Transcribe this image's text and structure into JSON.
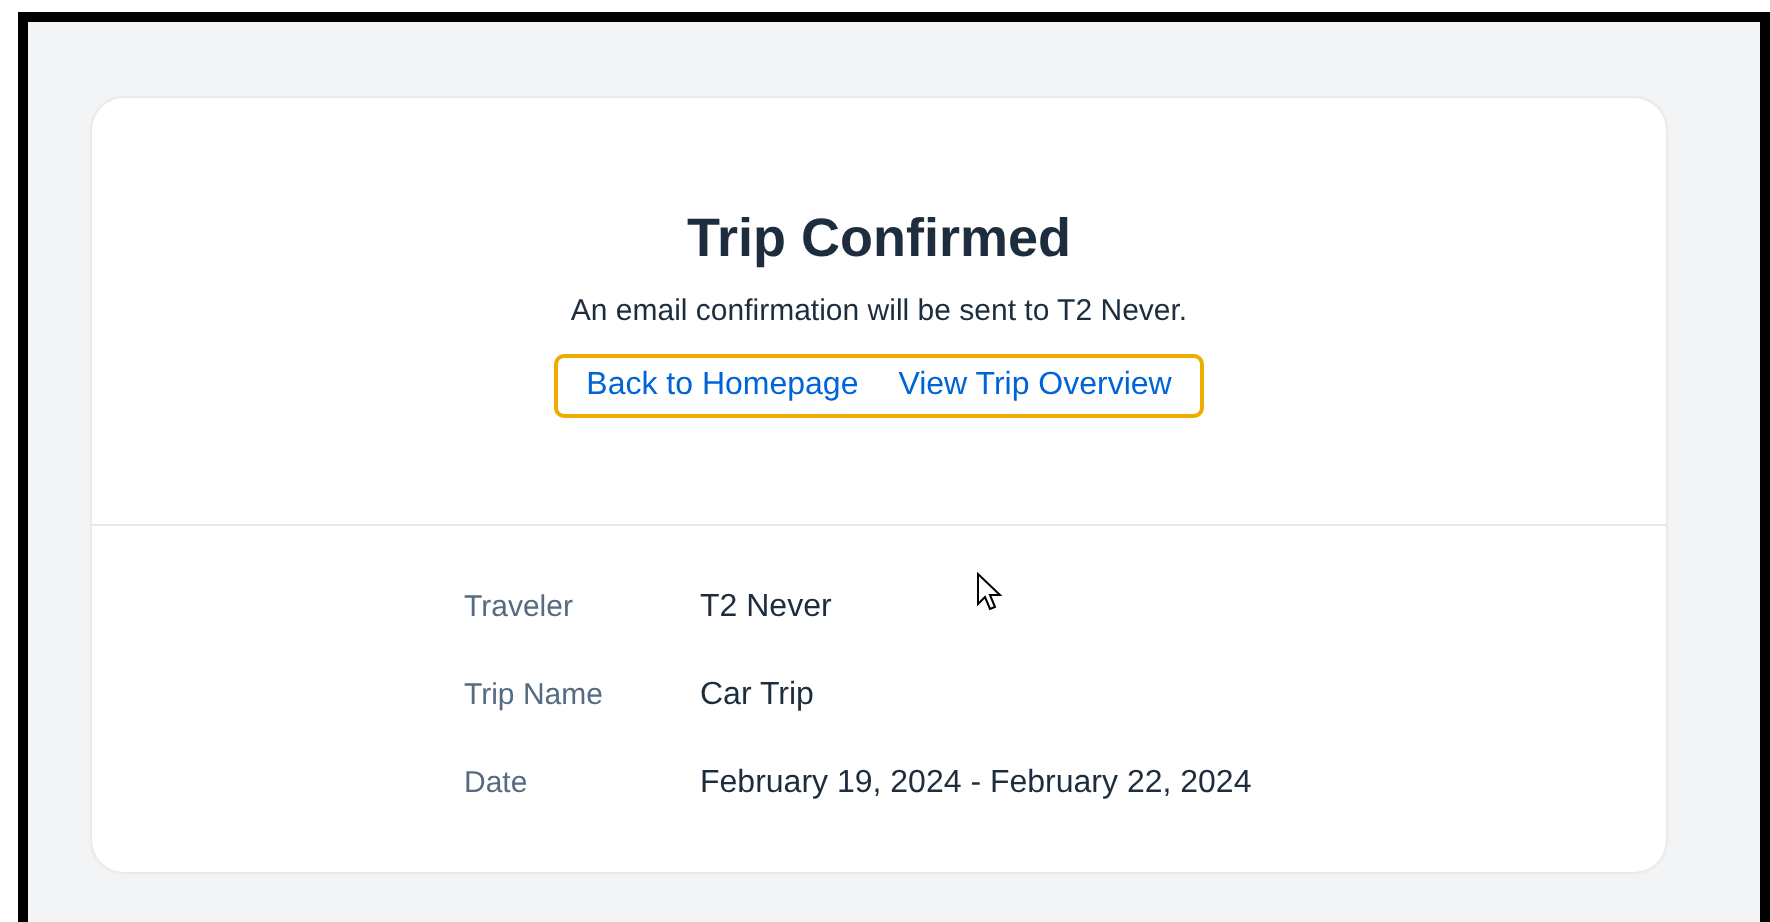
{
  "confirmation": {
    "title": "Trip Confirmed",
    "message": "An email confirmation will be sent to T2 Never.",
    "links": [
      {
        "label": "Back to Homepage"
      },
      {
        "label": "View Trip Overview"
      }
    ],
    "links_focused": true
  },
  "details": [
    {
      "label": "Traveler",
      "value": "T2 Never"
    },
    {
      "label": "Trip Name",
      "value": "Car Trip"
    },
    {
      "label": "Date",
      "value": "February 19, 2024 - February 22, 2024"
    }
  ]
}
